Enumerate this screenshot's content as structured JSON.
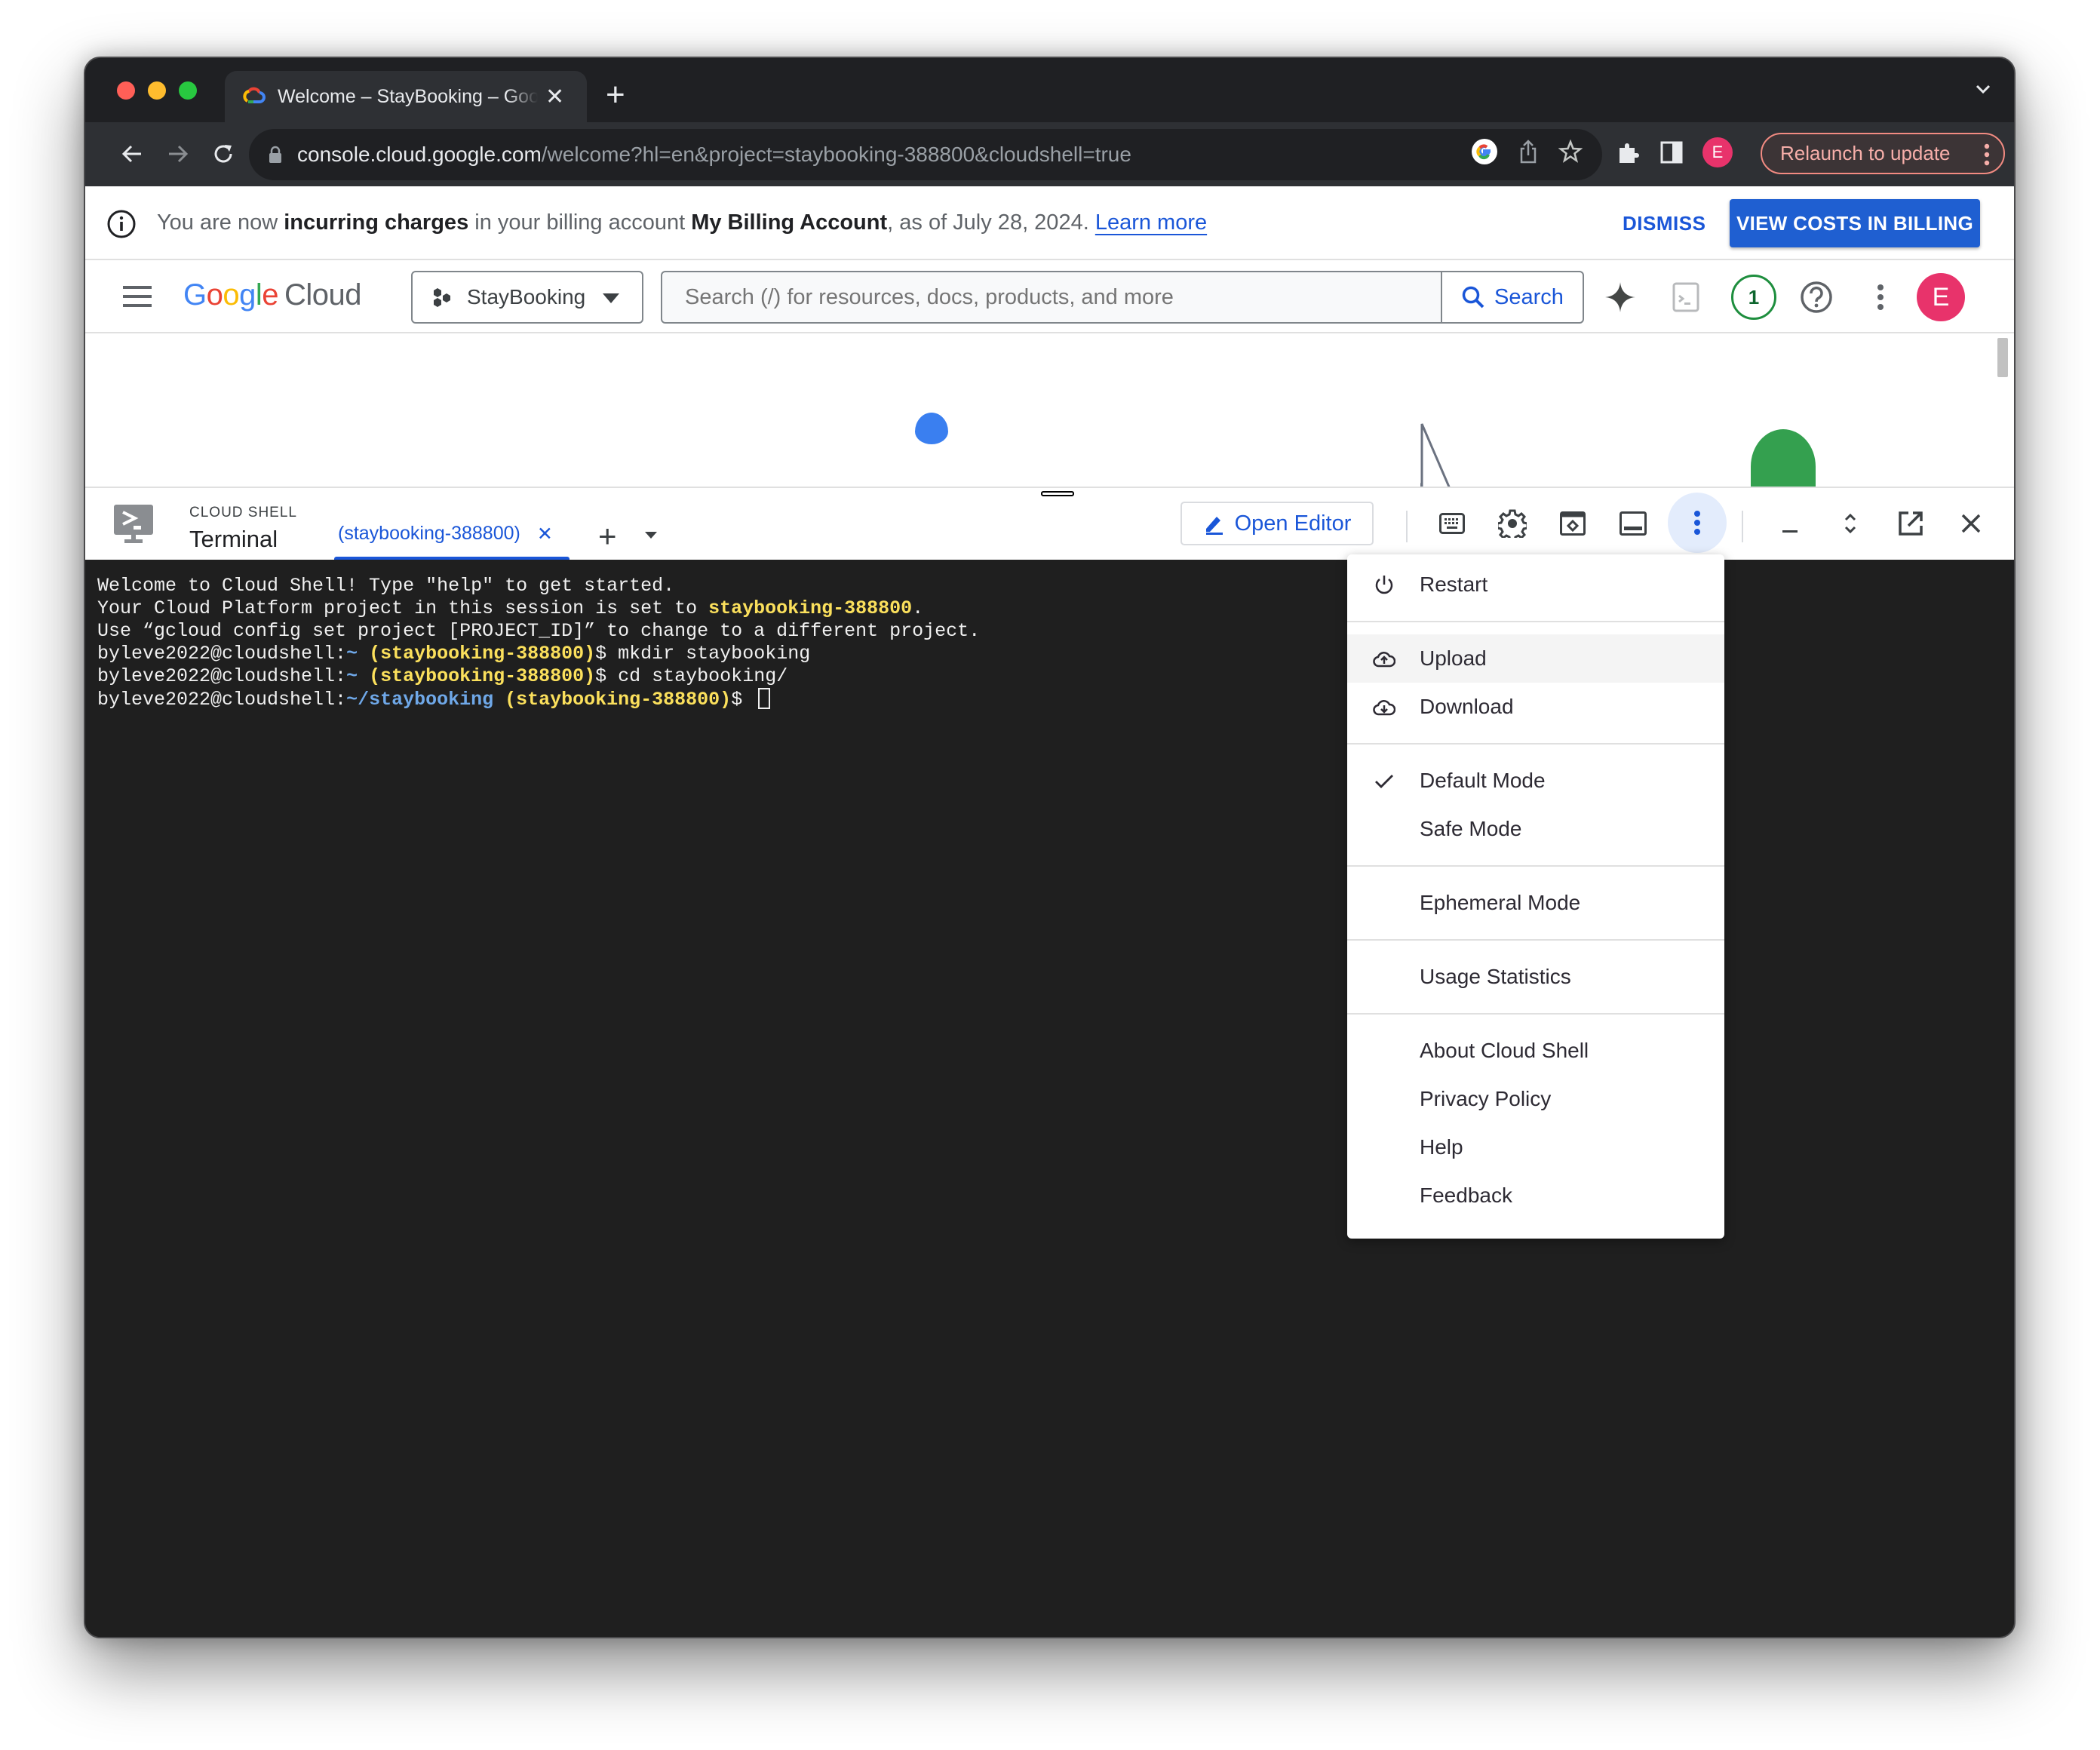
{
  "browser": {
    "tab_title": "Welcome – StayBooking – Google Cloud console",
    "url_host": "console.cloud.google.com",
    "url_path": "/welcome?hl=en&project=staybooking-388800&cloudshell=true",
    "profile_initial": "E",
    "relaunch_label": "Relaunch to update",
    "colors": {
      "relaunch_text": "#f6aea9",
      "profile": "#e8336b"
    }
  },
  "banner": {
    "text_1": "You are now ",
    "text_bold_1": "incurring charges",
    "text_2": " in your billing account ",
    "text_bold_2": "My Billing Account",
    "text_3": ", as of July 28, 2024. ",
    "learn_more": "Learn more",
    "dismiss_label": "DISMISS",
    "view_costs_label": "VIEW COSTS IN BILLING"
  },
  "gc_header": {
    "logo_google": [
      "G",
      "o",
      "o",
      "g",
      "l",
      "e"
    ],
    "logo_cloud": "Cloud",
    "project_name": "StayBooking",
    "search_placeholder": "Search (/) for resources, docs, products, and more",
    "search_button": "Search",
    "notifications_count": "1",
    "avatar_initial": "E"
  },
  "cloud_shell": {
    "label": "CLOUD SHELL",
    "title": "Terminal",
    "session_tab": "(staybooking-388800)",
    "open_editor": "Open Editor"
  },
  "terminal": {
    "lines": [
      {
        "segments": [
          {
            "text": "Welcome to Cloud Shell! Type \"help\" to get started.",
            "style": ""
          }
        ]
      },
      {
        "segments": [
          {
            "text": "Your Cloud Platform project in this session is set to ",
            "style": ""
          },
          {
            "text": "staybooking-388800",
            "style": "yellow"
          },
          {
            "text": ".",
            "style": ""
          }
        ]
      },
      {
        "segments": [
          {
            "text": "Use “gcloud config set project [PROJECT_ID]” to change to a different project.",
            "style": ""
          }
        ]
      },
      {
        "segments": [
          {
            "text": "byleve2022@cloudshell:",
            "style": ""
          },
          {
            "text": "~",
            "style": "blue"
          },
          {
            "text": " ",
            "style": ""
          },
          {
            "text": "(staybooking-388800)",
            "style": "yellow"
          },
          {
            "text": "$ mkdir staybooking",
            "style": ""
          }
        ]
      },
      {
        "segments": [
          {
            "text": "byleve2022@cloudshell:",
            "style": ""
          },
          {
            "text": "~",
            "style": "blue"
          },
          {
            "text": " ",
            "style": ""
          },
          {
            "text": "(staybooking-388800)",
            "style": "yellow"
          },
          {
            "text": "$ cd staybooking/",
            "style": ""
          }
        ]
      },
      {
        "segments": [
          {
            "text": "byleve2022@cloudshell:",
            "style": ""
          },
          {
            "text": "~/staybooking",
            "style": "blue"
          },
          {
            "text": " ",
            "style": ""
          },
          {
            "text": "(staybooking-388800)",
            "style": "yellow"
          },
          {
            "text": "$ ",
            "style": ""
          }
        ],
        "cursor": true
      }
    ]
  },
  "menu": {
    "groups": [
      [
        {
          "label": "Restart",
          "icon": "power-icon"
        }
      ],
      [
        {
          "label": "Upload",
          "icon": "cloud-upload-icon",
          "hovered": true
        },
        {
          "label": "Download",
          "icon": "cloud-download-icon"
        }
      ],
      [
        {
          "label": "Default Mode",
          "icon": "check-icon",
          "checked": true
        },
        {
          "label": "Safe Mode"
        }
      ],
      [
        {
          "label": "Ephemeral Mode"
        }
      ],
      [
        {
          "label": "Usage Statistics"
        }
      ],
      [
        {
          "label": "About Cloud Shell"
        },
        {
          "label": "Privacy Policy"
        },
        {
          "label": "Help"
        },
        {
          "label": "Feedback"
        }
      ]
    ]
  }
}
